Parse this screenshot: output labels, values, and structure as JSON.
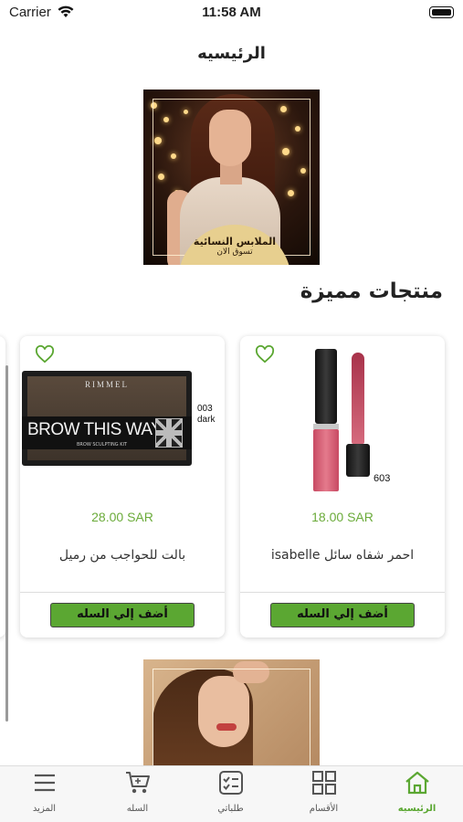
{
  "status_bar": {
    "carrier": "Carrier",
    "time": "11:58 AM"
  },
  "nav": {
    "title": "الرئيسيه"
  },
  "banner": {
    "title": "الملابس النسائية",
    "subtitle": "تسوق الان"
  },
  "featured": {
    "title": "منتجات مميزة"
  },
  "products": [
    {
      "name": "احمر شفاه سائل isabelle",
      "price": "18.00 SAR",
      "shade": "603",
      "add_label": "أضف إلي السله",
      "icon": "heart-outline-icon"
    },
    {
      "name": "بالت للحواجب من رميل",
      "price": "28.00 SAR",
      "shade": "003 dark",
      "brand_text": "RIMMEL",
      "product_text": "BROW THIS WAY",
      "product_sub": "BROW SCULPTING KIT",
      "add_label": "أضف إلي السله",
      "icon": "heart-outline-icon"
    }
  ],
  "tabs": [
    {
      "label": "الرئيسيه",
      "icon": "home-icon",
      "active": true
    },
    {
      "label": "الأقسام",
      "icon": "grid-icon",
      "active": false
    },
    {
      "label": "طلباتي",
      "icon": "checklist-icon",
      "active": false
    },
    {
      "label": "السله",
      "icon": "cart-icon",
      "active": false
    },
    {
      "label": "المزيد",
      "icon": "menu-icon",
      "active": false
    }
  ],
  "colors": {
    "accent": "#5ba732",
    "price": "#6bab3a"
  }
}
